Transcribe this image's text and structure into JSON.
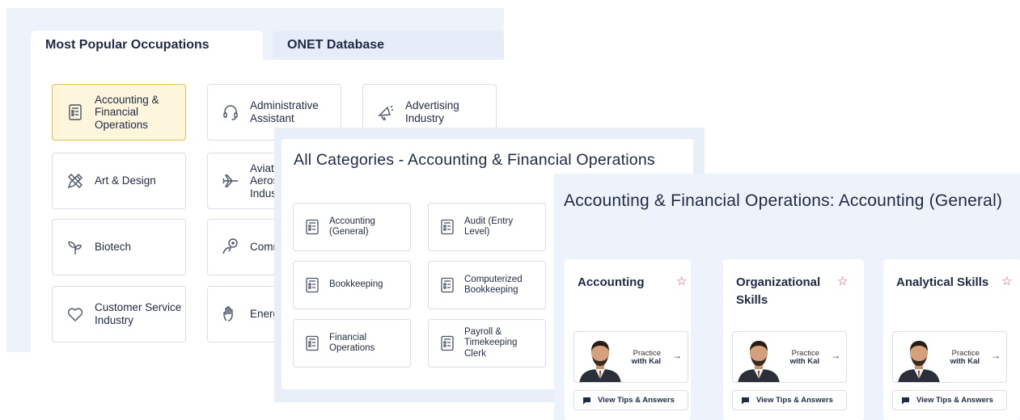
{
  "occupations_panel": {
    "tabs": [
      {
        "label": "Most Popular Occupations",
        "active": true
      },
      {
        "label": "ONET Database",
        "active": false
      }
    ],
    "items": [
      {
        "label": "Accounting & Financial Operations",
        "icon": "list-document-icon",
        "selected": true
      },
      {
        "label": "Administrative Assistant",
        "icon": "headset-icon"
      },
      {
        "label": "Advertising Industry",
        "icon": "megaphone-icon"
      },
      {
        "label": "Art & Design",
        "icon": "pencil-ruler-icon"
      },
      {
        "label": "Aviation, Aerospace Industry",
        "visible_text": "Aviati Aeros Indust",
        "icon": "airplane-icon"
      },
      {
        "label": "Biotech",
        "icon": "sprout-icon"
      },
      {
        "label": "Communications",
        "visible_text": "Comm",
        "icon": "speech-hand-icon"
      },
      {
        "label": "Customer Service Industry",
        "icon": "heart-icon"
      },
      {
        "label": "Energy",
        "visible_text": "Energ",
        "icon": "hand-icon"
      }
    ]
  },
  "categories_panel": {
    "title": "All Categories - Accounting & Financial Operations",
    "items": [
      {
        "label": "Accounting (General)",
        "icon": "list-document-icon"
      },
      {
        "label": "Audit (Entry Level)",
        "icon": "list-document-icon"
      },
      {
        "label": "Bookkeeping",
        "icon": "list-document-icon"
      },
      {
        "label": "Computerized Bookkeeping",
        "icon": "list-document-icon"
      },
      {
        "label": "Financial Operations",
        "icon": "list-document-icon"
      },
      {
        "label": "Payroll & Timekeeping Clerk",
        "icon": "list-document-icon"
      }
    ]
  },
  "skills_panel": {
    "title": "Accounting & Financial Operations: Accounting (General)",
    "cards": [
      {
        "name": "Accounting",
        "practice_line1": "Practice",
        "practice_line2": "with Kal",
        "tips_label": "View Tips & Answers"
      },
      {
        "name": "Organizational Skills",
        "practice_line1": "Practice",
        "practice_line2": "with Kal",
        "tips_label": "View Tips & Answers"
      },
      {
        "name": "Analytical Skills",
        "practice_line1": "Practice",
        "practice_line2": "with Kal",
        "tips_label": "View Tips & Answers"
      }
    ],
    "favorite_icon": "star-outline-icon",
    "arrow_glyph": "→"
  },
  "colors": {
    "selected_bg": "#fdf5dc",
    "selected_border": "#e8c04a",
    "star": "#e0456b",
    "panel_bg": "#eef3fb"
  }
}
